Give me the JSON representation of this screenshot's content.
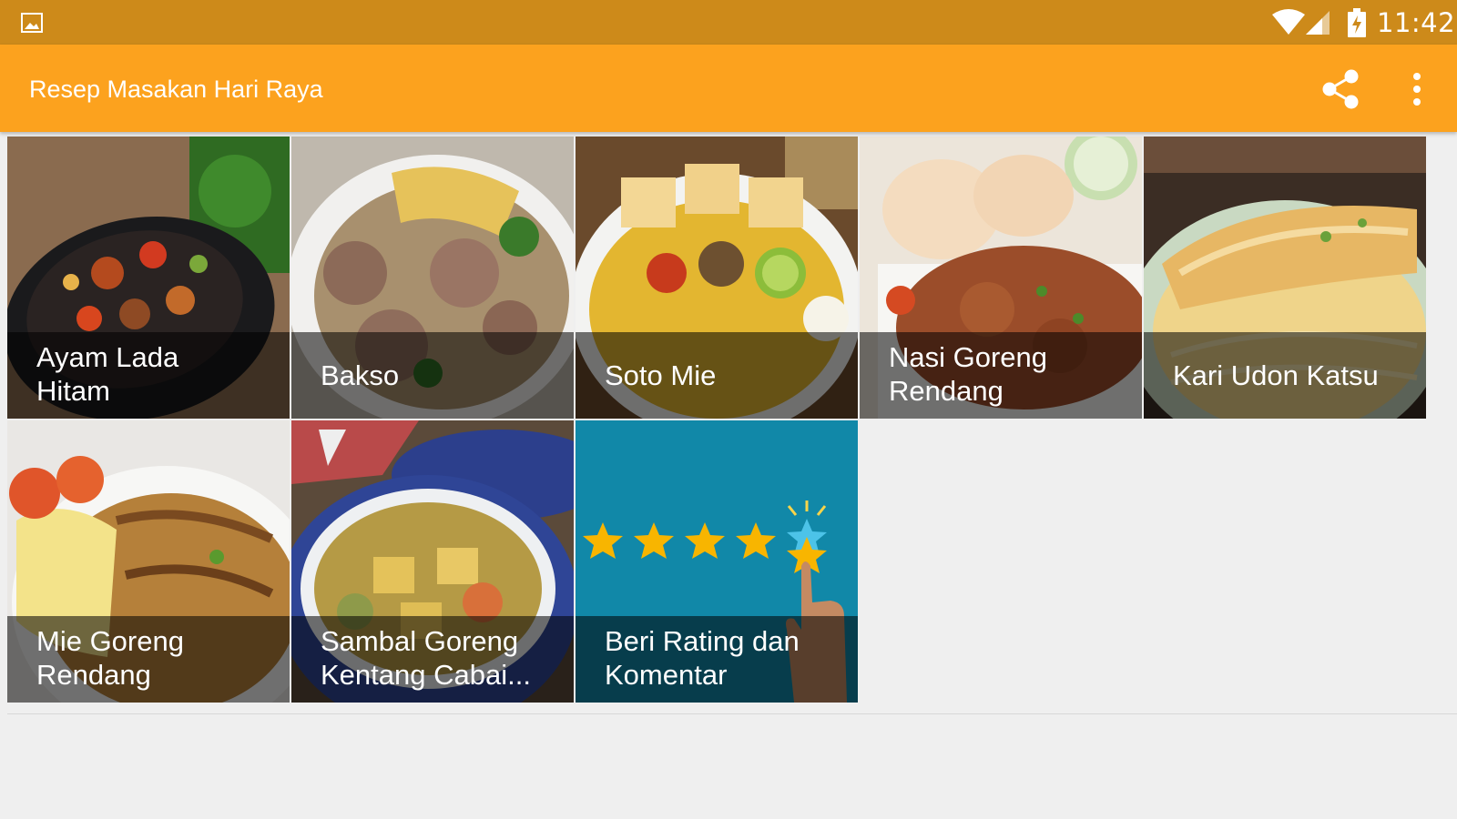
{
  "status_bar": {
    "time": "11:42",
    "icons": [
      "gallery-icon",
      "wifi-icon",
      "signal-icon",
      "battery-charging-icon"
    ]
  },
  "app_bar": {
    "title": "Resep Masakan Hari Raya",
    "actions": [
      "share-icon",
      "more-vert-icon"
    ],
    "color": "#fca21e"
  },
  "status_color": "#cd8a1a",
  "recipes": [
    {
      "label": "Ayam Lada\nHitam"
    },
    {
      "label": "Bakso"
    },
    {
      "label": "Soto Mie"
    },
    {
      "label": "Nasi Goreng\nRendang"
    },
    {
      "label": "Kari Udon Katsu"
    },
    {
      "label": "Mie Goreng\nRendang"
    },
    {
      "label": "Sambal Goreng\nKentang Cabai..."
    },
    {
      "label": "Beri Rating dan\nKomentar"
    }
  ]
}
